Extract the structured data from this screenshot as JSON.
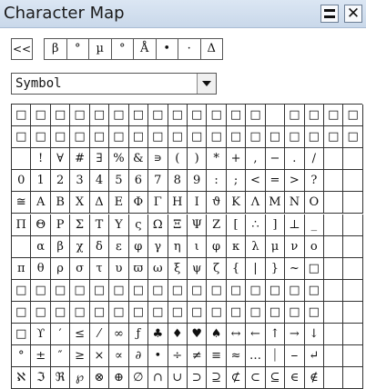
{
  "window": {
    "title": "Character Map",
    "menu_icon": "menu-icon",
    "close_label": "✕"
  },
  "toolbar": {
    "back_label": "<<",
    "recent": [
      "β",
      "°",
      "µ",
      "°",
      "Å",
      "•",
      "·",
      "Δ"
    ]
  },
  "font_select": {
    "value": "Symbol"
  },
  "grid": {
    "columns": 18,
    "rows": [
      [
        "□",
        "□",
        "□",
        "□",
        "□",
        "□",
        "□",
        "□",
        "□",
        "□",
        "□",
        "□",
        "□",
        "",
        "□",
        "□",
        "□",
        "□"
      ],
      [
        "□",
        "□",
        "□",
        "□",
        "□",
        "□",
        "□",
        "□",
        "□",
        "□",
        "□",
        "□",
        "□",
        "□",
        "□",
        "□",
        "□",
        "□"
      ],
      [
        "",
        "!",
        "∀",
        "#",
        "∃",
        "%",
        "&",
        "∍",
        "(",
        ")",
        "*",
        "+",
        ",",
        "−",
        ".",
        "/",
        "",
        ""
      ],
      [
        "0",
        "1",
        "2",
        "3",
        "4",
        "5",
        "6",
        "7",
        "8",
        "9",
        ":",
        ";",
        "<",
        "=",
        ">",
        "?",
        "",
        ""
      ],
      [
        "≅",
        "Α",
        "Β",
        "Χ",
        "Δ",
        "Ε",
        "Φ",
        "Γ",
        "Η",
        "Ι",
        "ϑ",
        "Κ",
        "Λ",
        "Μ",
        "Ν",
        "Ο",
        "",
        ""
      ],
      [
        "Π",
        "Θ",
        "Ρ",
        "Σ",
        "Τ",
        "Υ",
        "ς",
        "Ω",
        "Ξ",
        "Ψ",
        "Ζ",
        "[",
        "∴",
        "]",
        "⊥",
        "_",
        "",
        ""
      ],
      [
        "",
        "α",
        "β",
        "χ",
        "δ",
        "ε",
        "φ",
        "γ",
        "η",
        "ι",
        "φ",
        "κ",
        "λ",
        "μ",
        "ν",
        "ο",
        "",
        ""
      ],
      [
        "π",
        "θ",
        "ρ",
        "σ",
        "τ",
        "υ",
        "ϖ",
        "ω",
        "ξ",
        "ψ",
        "ζ",
        "{",
        "|",
        "}",
        "~",
        "□",
        "",
        ""
      ],
      [
        "□",
        "□",
        "□",
        "□",
        "□",
        "□",
        "□",
        "□",
        "□",
        "□",
        "□",
        "□",
        "□",
        "□",
        "□",
        "□",
        "",
        ""
      ],
      [
        "□",
        "□",
        "□",
        "□",
        "□",
        "□",
        "□",
        "□",
        "□",
        "□",
        "□",
        "□",
        "□",
        "□",
        "□",
        "□",
        "",
        ""
      ],
      [
        "□",
        "ϒ",
        "′",
        "≤",
        "⁄",
        "∞",
        "ƒ",
        "♣",
        "♦",
        "♥",
        "♠",
        "↔",
        "←",
        "↑",
        "→",
        "↓",
        "",
        ""
      ],
      [
        "°",
        "±",
        "″",
        "≥",
        "×",
        "∝",
        "∂",
        "•",
        "÷",
        "≠",
        "≡",
        "≈",
        "…",
        "⏐",
        "⎯",
        "↵",
        "",
        ""
      ],
      [
        "ℵ",
        "ℑ",
        "ℜ",
        "℘",
        "⊗",
        "⊕",
        "∅",
        "∩",
        "∪",
        "⊃",
        "⊇",
        "⊄",
        "⊂",
        "⊆",
        "∈",
        "∉",
        "",
        ""
      ]
    ]
  },
  "colors": {
    "titlebar": "#d4e1f0",
    "border": "#333333"
  }
}
